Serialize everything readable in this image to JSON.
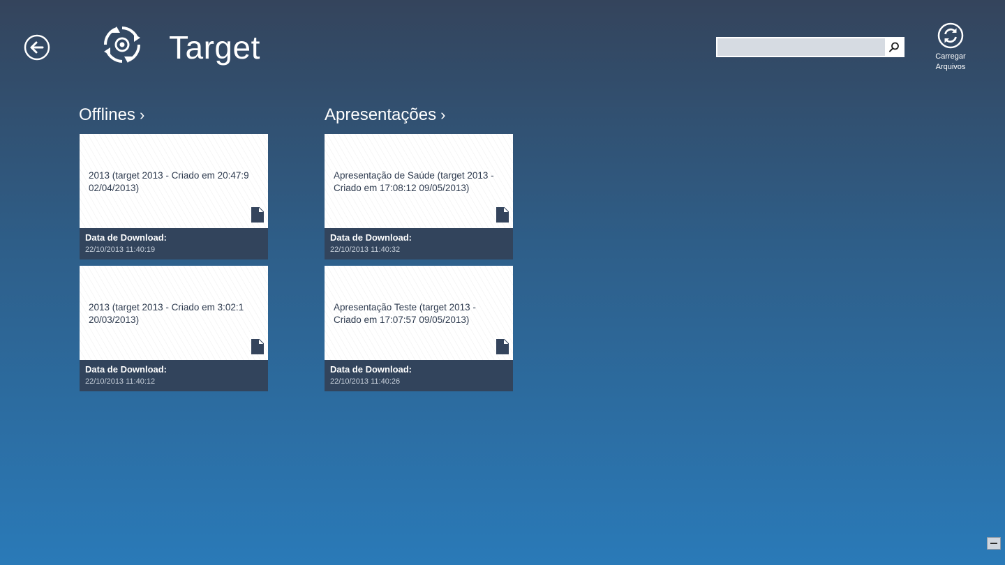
{
  "app": {
    "title": "Target"
  },
  "search": {
    "value": "",
    "placeholder": ""
  },
  "refresh": {
    "label_line1": "Carregar",
    "label_line2": "Arquivos"
  },
  "groups": [
    {
      "header": "Offlines",
      "chevron": "›",
      "tiles": [
        {
          "title": "2013 (target 2013 - Criado em 20:47:9 02/04/2013)",
          "download_label": "Data de Download:",
          "download_date": "22/10/2013 11:40:19"
        },
        {
          "title": "2013 (target 2013 - Criado em 3:02:1 20/03/2013)",
          "download_label": "Data de Download:",
          "download_date": "22/10/2013 11:40:12"
        }
      ]
    },
    {
      "header": "Apresentações",
      "chevron": "›",
      "tiles": [
        {
          "title": "Apresentação de Saúde (target 2013 - Criado em 17:08:12 09/05/2013)",
          "download_label": "Data de Download:",
          "download_date": "22/10/2013 11:40:32"
        },
        {
          "title": "Apresentação Teste (target 2013 - Criado em 17:07:57 09/05/2013)",
          "download_label": "Data de Download:",
          "download_date": "22/10/2013 11:40:26"
        }
      ]
    }
  ],
  "icons": {
    "back": "back-arrow-icon",
    "logo": "target-logo-icon",
    "search": "search-icon",
    "refresh": "refresh-icon",
    "document": "document-icon",
    "minimize": "minimize-icon"
  },
  "colors": {
    "background_top": "#34445c",
    "background_bottom": "#2a7ab8",
    "tile_footer": "#32445c",
    "tile_body": "#ffffff"
  }
}
